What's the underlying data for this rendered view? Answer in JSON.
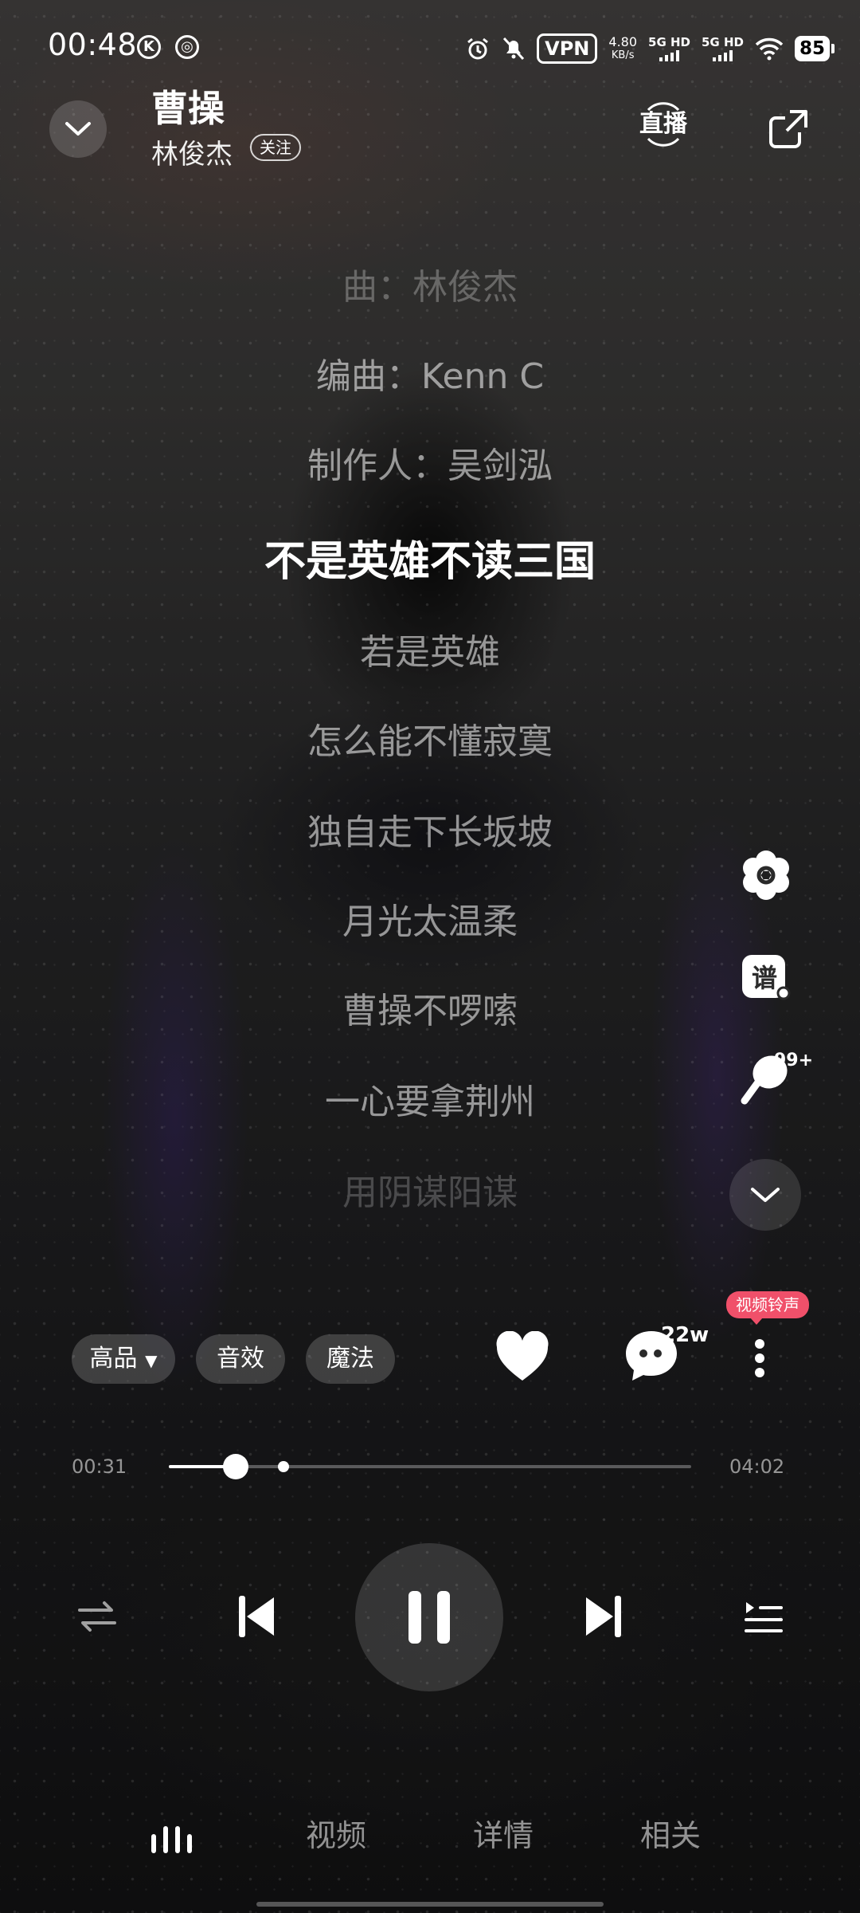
{
  "status_bar": {
    "time": "00:48",
    "vpn": "VPN",
    "speed_value": "4.80",
    "speed_unit": "KB/s",
    "net1": "5G HD",
    "net2": "5G HD",
    "battery": "85"
  },
  "header": {
    "title": "曹操",
    "artist": "林俊杰",
    "follow_label": "关注",
    "live_label": "直播"
  },
  "lyrics": {
    "lines": [
      "曲：林俊杰",
      "编曲：Kenn C",
      "制作人：吴剑泓",
      "不是英雄不读三国",
      "若是英雄",
      "怎么能不懂寂寞",
      "独自走下长坂坡",
      "月光太温柔",
      "曹操不啰嗦",
      "一心要拿荆州",
      "用阴谋阳谋"
    ],
    "active_index": 3
  },
  "side_tools": {
    "score_label": "谱",
    "sing_count": "99+"
  },
  "actions": {
    "quality_label": "高品",
    "effect_label": "音效",
    "magic_label": "魔法",
    "comment_count": "22w",
    "ringtone_label": "视频铃声"
  },
  "progress": {
    "current": "00:31",
    "total": "04:02",
    "played_fraction": 0.128,
    "buffered_mark_fraction": 0.22
  },
  "tabs": {
    "video": "视频",
    "detail": "详情",
    "related": "相关"
  },
  "colors": {
    "ringtone_badge": "#f0506a"
  }
}
